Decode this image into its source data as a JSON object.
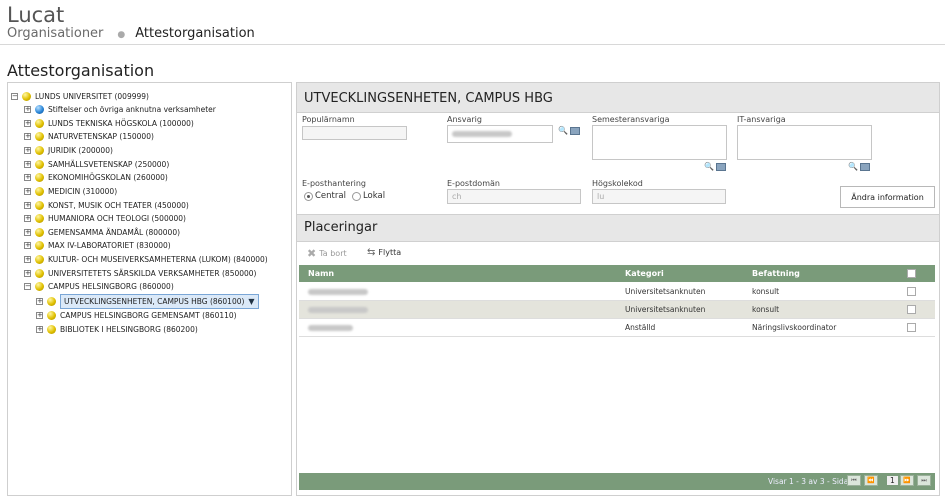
{
  "app": {
    "title": "Lucat"
  },
  "breadcrumb": {
    "item1": "Organisationer",
    "item2": "Attestorganisation"
  },
  "page": {
    "title": "Attestorganisation"
  },
  "tree": {
    "items": [
      {
        "label": "LUNDS UNIVERSITET (009999)",
        "level": 0,
        "toggle": "−",
        "icon": "yellow-ball"
      },
      {
        "label": "Stiftelser och övriga anknutna verksamheter",
        "level": 1,
        "toggle": "+",
        "icon": "blue-ball"
      },
      {
        "label": "LUNDS TEKNISKA HÖGSKOLA (100000)",
        "level": 1,
        "toggle": "+",
        "icon": "yellow-ball"
      },
      {
        "label": "NATURVETENSKAP (150000)",
        "level": 1,
        "toggle": "+",
        "icon": "yellow-ball"
      },
      {
        "label": "JURIDIK (200000)",
        "level": 1,
        "toggle": "+",
        "icon": "yellow-ball"
      },
      {
        "label": "SAMHÄLLSVETENSKAP (250000)",
        "level": 1,
        "toggle": "+",
        "icon": "yellow-ball"
      },
      {
        "label": "EKONOMIHÖGSKOLAN (260000)",
        "level": 1,
        "toggle": "+",
        "icon": "yellow-ball"
      },
      {
        "label": "MEDICIN (310000)",
        "level": 1,
        "toggle": "+",
        "icon": "yellow-ball"
      },
      {
        "label": "KONST, MUSIK OCH TEATER (450000)",
        "level": 1,
        "toggle": "+",
        "icon": "yellow-ball"
      },
      {
        "label": "HUMANIORA OCH TEOLOGI (500000)",
        "level": 1,
        "toggle": "+",
        "icon": "yellow-ball"
      },
      {
        "label": "GEMENSAMMA ÄNDAMÅL (800000)",
        "level": 1,
        "toggle": "+",
        "icon": "yellow-ball"
      },
      {
        "label": "MAX IV-LABORATORIET (830000)",
        "level": 1,
        "toggle": "+",
        "icon": "yellow-ball"
      },
      {
        "label": "KULTUR- OCH MUSEIVERKSAMHETERNA (LUKOM) (840000)",
        "level": 1,
        "toggle": "+",
        "icon": "yellow-ball"
      },
      {
        "label": "UNIVERSITETETS SÄRSKILDA VERKSAMHETER (850000)",
        "level": 1,
        "toggle": "+",
        "icon": "yellow-ball"
      },
      {
        "label": "CAMPUS HELSINGBORG (860000)",
        "level": 1,
        "toggle": "−",
        "icon": "yellow-ball"
      },
      {
        "label": "UTVECKLINGSENHETEN, CAMPUS HBG (860100)",
        "level": 2,
        "toggle": "+",
        "icon": "yellow-ball",
        "selected": true
      },
      {
        "label": "CAMPUS HELSINGBORG GEMENSAMT (860110)",
        "level": 2,
        "toggle": "+",
        "icon": "yellow-ball"
      },
      {
        "label": "BIBLIOTEK I HELSINGBORG (860200)",
        "level": 2,
        "toggle": "+",
        "icon": "yellow-ball"
      }
    ]
  },
  "detail": {
    "title": "UTVECKLINGSENHETEN, CAMPUS HBG",
    "labels": {
      "popularnamn": "Populärnamn",
      "ansvarig": "Ansvarig",
      "semesteransvariga": "Semesteransvariga",
      "it_ansvariga": "IT-ansvariga",
      "e_posthantering": "E-posthantering",
      "e_postdoman": "E-postdomän",
      "hogskolekod": "Högskolekod"
    },
    "values": {
      "popularnamn": "",
      "e_postdoman": "ch",
      "hogskolekod": "lu"
    },
    "radio": {
      "central": "Central",
      "lokal": "Lokal",
      "selected": "Central"
    },
    "change_button": "Ändra information"
  },
  "placements": {
    "title": "Placeringar",
    "toolbar": {
      "delete": "Ta bort",
      "move": "Flytta"
    },
    "columns": {
      "namn": "Namn",
      "kategori": "Kategori",
      "befattning": "Befattning"
    },
    "rows": [
      {
        "kategori": "Universitetsanknuten",
        "befattning": "konsult",
        "shaded": false
      },
      {
        "kategori": "Universitetsanknuten",
        "befattning": "konsult",
        "shaded": true
      },
      {
        "kategori": "Anställd",
        "befattning": "Näringslivskoordinator",
        "shaded": false
      }
    ],
    "footer": {
      "status": "Visar 1 - 3 av 3 - Sida",
      "page": "1"
    }
  }
}
